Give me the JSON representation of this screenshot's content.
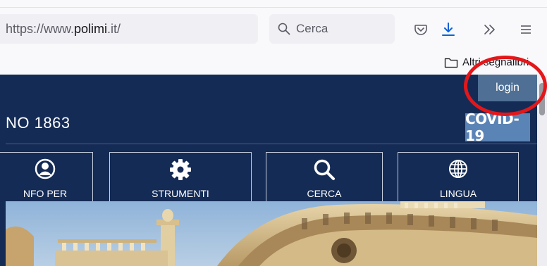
{
  "browser": {
    "url_prefix": "https://www.",
    "url_host": "polimi",
    "url_suffix": ".it/",
    "search_placeholder": "Cerca",
    "bookmarks_folder_label": "Altri segnalibri",
    "icons": [
      "search-icon",
      "pocket-icon",
      "download-icon",
      "overflow-chevrons-icon",
      "hamburger-menu-icon",
      "folder-icon"
    ]
  },
  "site": {
    "login_label": "login",
    "year_text": "NO 1863",
    "covid_label": "COVID-19",
    "nav": [
      {
        "label": "NFO PER",
        "icon": "user-circle-icon"
      },
      {
        "label": "STRUMENTI",
        "icon": "gear-icon"
      },
      {
        "label": "CERCA",
        "icon": "magnifier-icon"
      },
      {
        "label": "LINGUA",
        "icon": "globe-icon"
      }
    ]
  },
  "colors": {
    "header_bg": "#142b55",
    "login_bg": "#4f6f94",
    "covid_bg": "#5b84b6",
    "annotation": "#e3171a"
  },
  "annotation": {
    "shape": "circle",
    "highlights": "login-button"
  }
}
